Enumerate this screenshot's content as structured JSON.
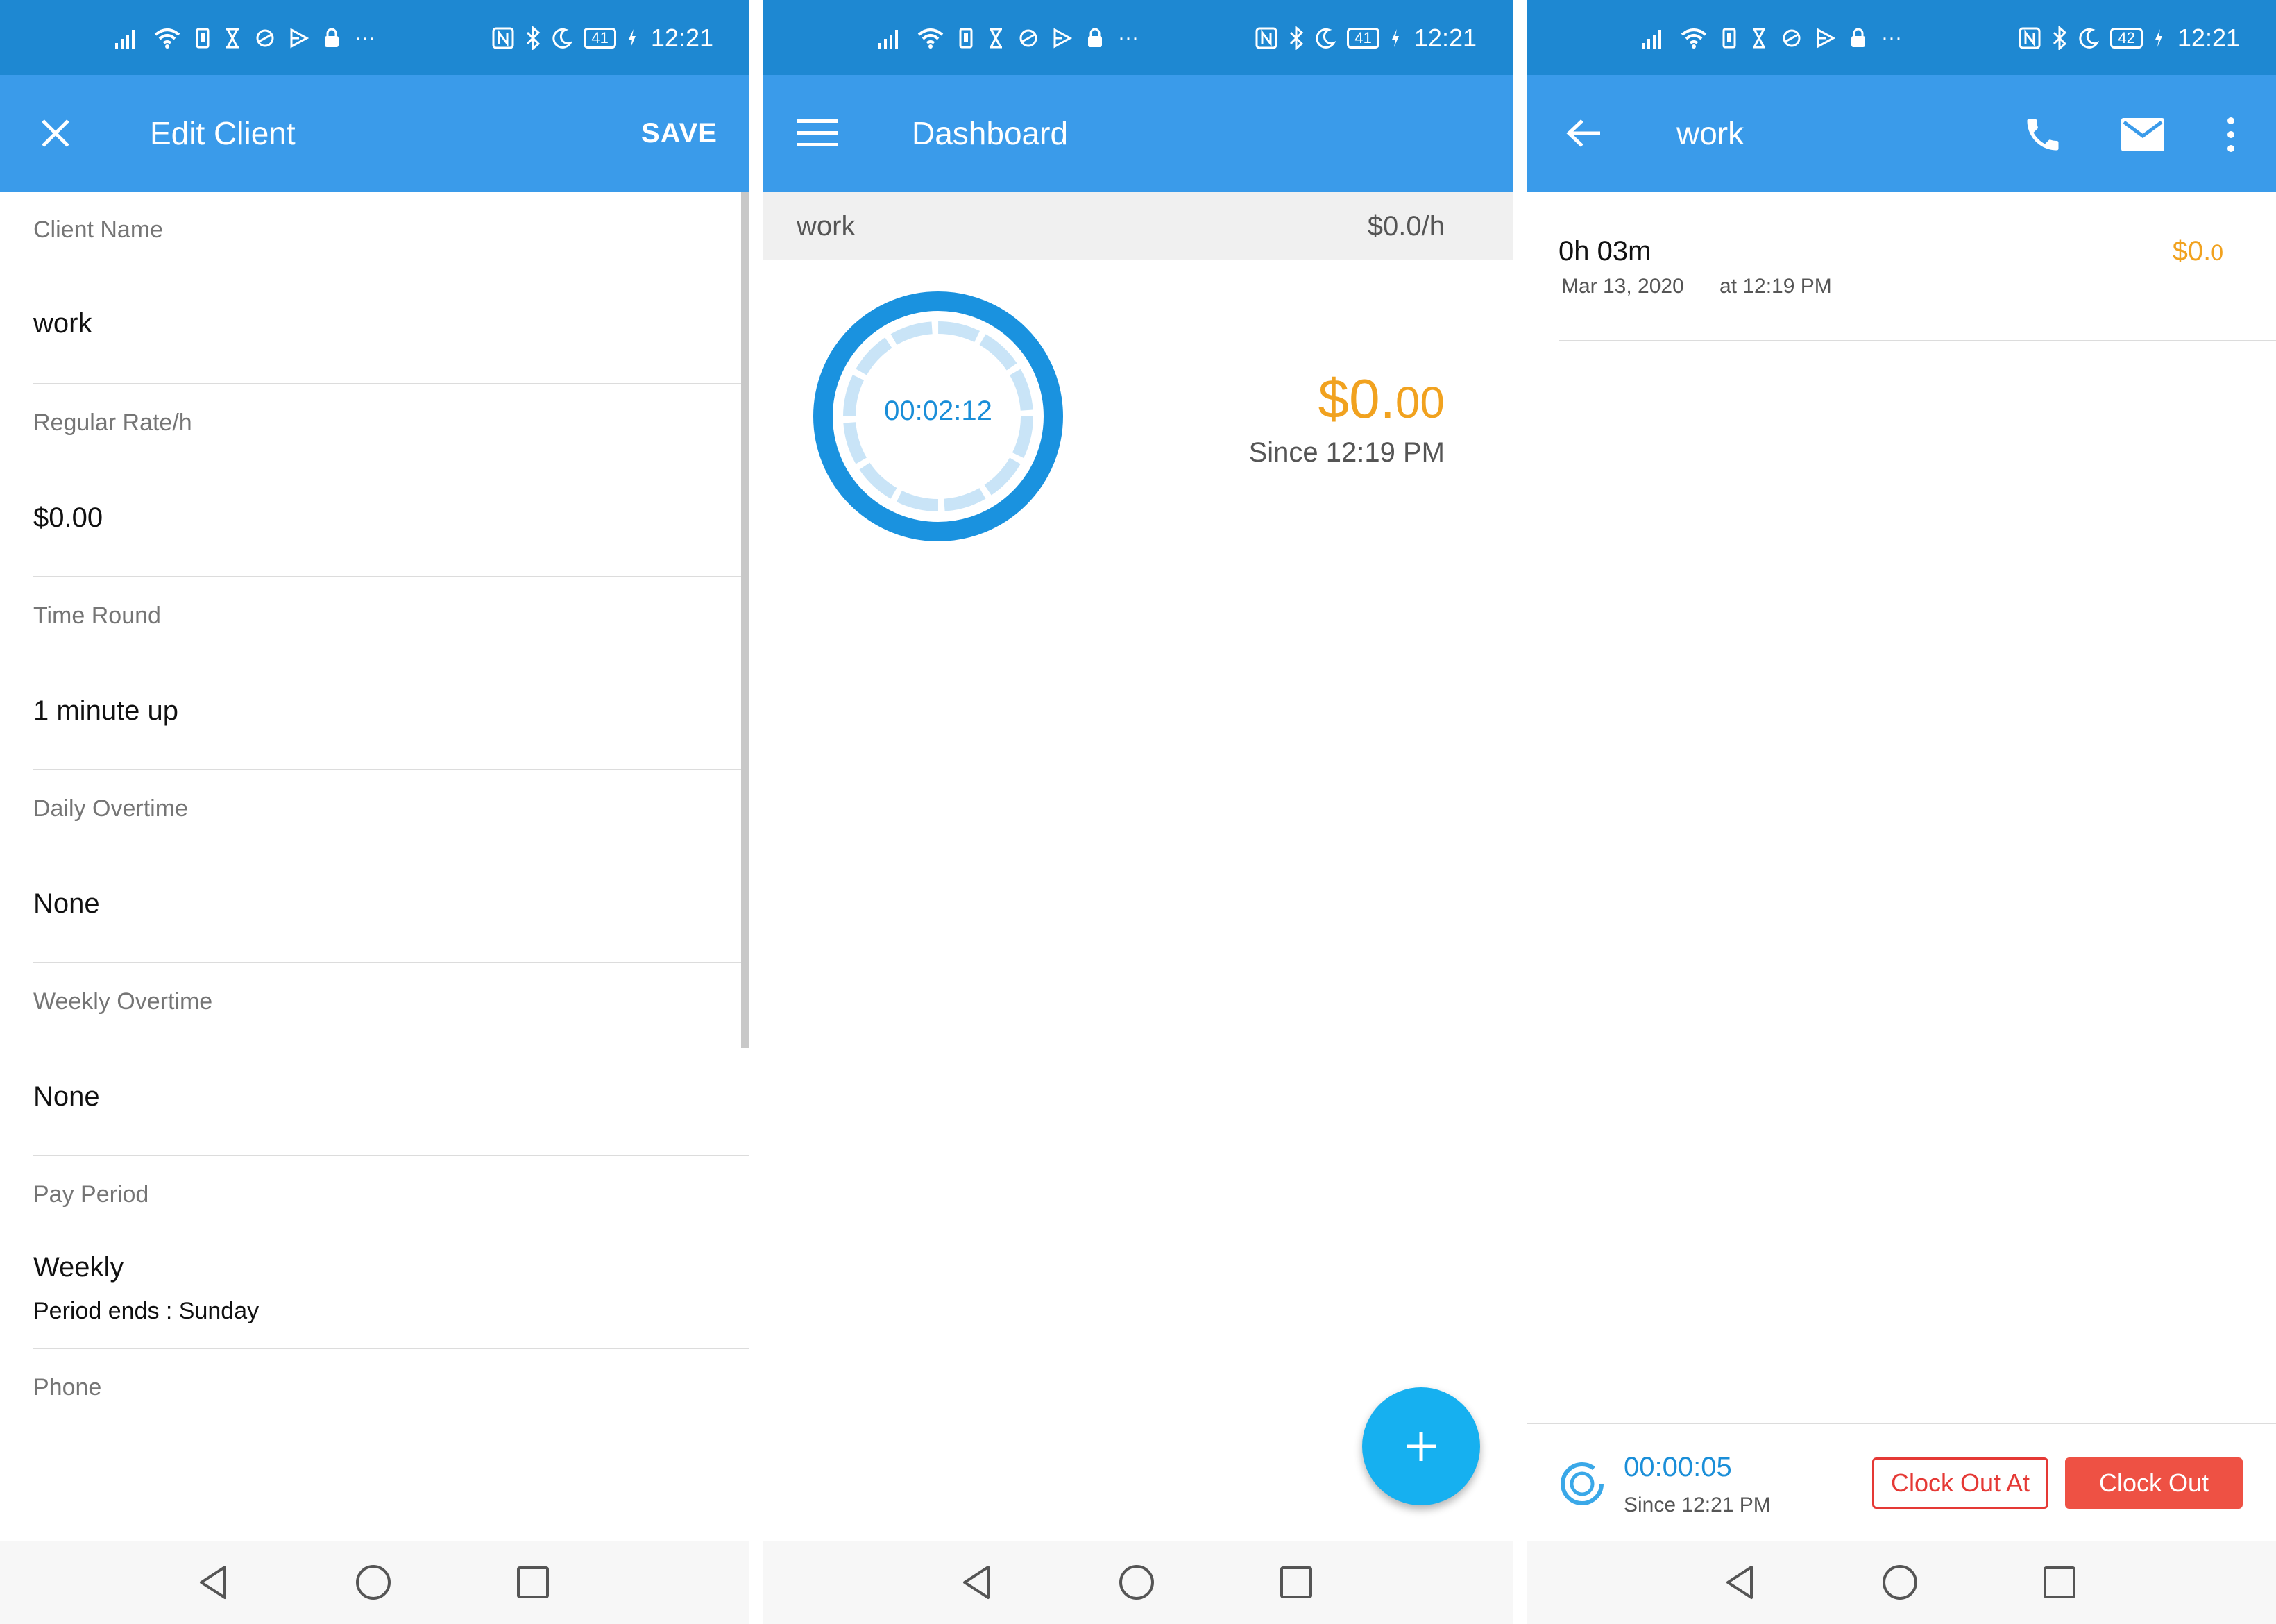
{
  "status_bar": {
    "time": "12:21",
    "battery": [
      "41",
      "41",
      "42"
    ],
    "overflow": "···",
    "icons_left": [
      "signal-icon",
      "wifi-icon",
      "vibrate-icon",
      "hourglass-icon",
      "sync-icon",
      "play-icon",
      "lock-icon"
    ],
    "icons_right": [
      "nfc-icon",
      "bluetooth-icon",
      "moon-icon",
      "battery-icon",
      "charging-icon"
    ]
  },
  "edit_client": {
    "title": "Edit Client",
    "save_label": "SAVE",
    "fields": [
      {
        "label": "Client Name",
        "value": "work"
      },
      {
        "label": "Regular Rate/h",
        "value": "$0.00"
      },
      {
        "label": "Time Round",
        "value": "1 minute up"
      },
      {
        "label": "Daily Overtime",
        "value": "None"
      },
      {
        "label": "Weekly Overtime",
        "value": "None"
      },
      {
        "label": "Pay Period",
        "value": "Weekly",
        "sub": "Period ends : Sunday"
      },
      {
        "label": "Phone",
        "value": ""
      }
    ]
  },
  "dashboard": {
    "title": "Dashboard",
    "client_name": "work",
    "client_rate": "$0.0/h",
    "timer": "00:02:12",
    "amount_main": "$0.",
    "amount_cents": "00",
    "since": "Since 12:19 PM",
    "fab_label": "+"
  },
  "client_detail": {
    "title": "work",
    "entry": {
      "duration": "0h 03m",
      "date": "Mar 13, 2020",
      "time": "at 12:19 PM",
      "amount_main": "$0.",
      "amount_cents": "0"
    },
    "timer": "00:00:05",
    "since": "Since 12:21 PM",
    "clock_out_at_label": "Clock Out At",
    "clock_out_label": "Clock Out"
  },
  "colors": {
    "status_bar": "#1e88d2",
    "app_bar": "#3a9bea",
    "amount": "#f1a21f",
    "timer_text": "#1a8ed8",
    "fab": "#16b0f0",
    "clock_out": "#ee5144"
  }
}
